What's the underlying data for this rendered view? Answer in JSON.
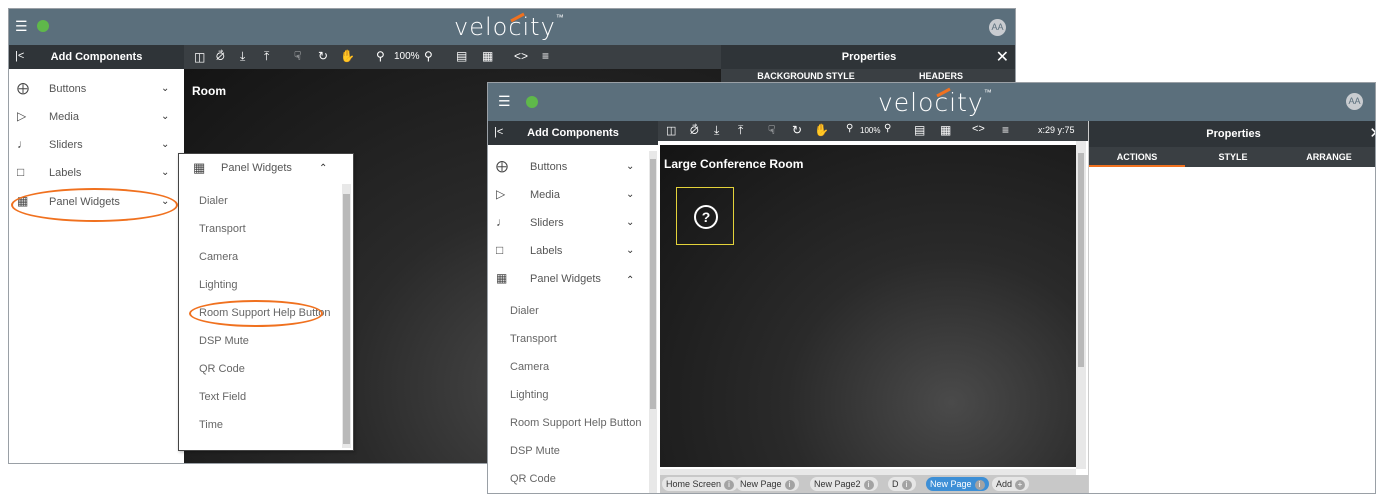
{
  "app": {
    "brand": "velocity",
    "avatar": "AA"
  },
  "back": {
    "panel_title": "Add Components",
    "categories": [
      {
        "label": "Buttons",
        "icon": "plus-circle-icon"
      },
      {
        "label": "Media",
        "icon": "play-circle-icon"
      },
      {
        "label": "Sliders",
        "icon": "volume-icon"
      },
      {
        "label": "Labels",
        "icon": "label-icon"
      },
      {
        "label": "Panel Widgets",
        "icon": "widgets-icon"
      }
    ],
    "zoom": "100%",
    "canvas_title": "Room",
    "properties_title": "Properties",
    "props_tabs": [
      "BACKGROUND STYLE",
      "HEADERS"
    ]
  },
  "dropdown": {
    "title": "Panel Widgets",
    "items": [
      "Dialer",
      "Transport",
      "Camera",
      "Lighting",
      "Room Support Help Button",
      "DSP Mute",
      "QR Code",
      "Text Field",
      "Time"
    ]
  },
  "front": {
    "panel_title": "Add Components",
    "categories": [
      {
        "label": "Buttons"
      },
      {
        "label": "Media"
      },
      {
        "label": "Sliders"
      },
      {
        "label": "Labels"
      },
      {
        "label": "Panel Widgets"
      }
    ],
    "widgets": [
      "Dialer",
      "Transport",
      "Camera",
      "Lighting",
      "Room Support Help Button",
      "DSP Mute",
      "QR Code"
    ],
    "zoom": "100%",
    "coords": "x:29 y:75",
    "canvas_title": "Large Conference Room",
    "help_glyph": "?",
    "properties_title": "Properties",
    "props_tabs": [
      "ACTIONS",
      "STYLE",
      "ARRANGE"
    ],
    "page_tabs": [
      "Home Screen",
      "New Page",
      "New Page2",
      "D",
      "New Page",
      "Add"
    ]
  },
  "colors": {
    "header": "#5b6f7c",
    "accent": "#f0711f",
    "active_tab": "#3d8fd6",
    "selection": "#e3d23a"
  }
}
